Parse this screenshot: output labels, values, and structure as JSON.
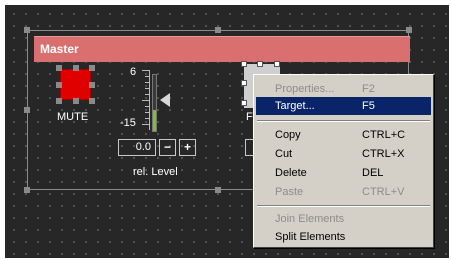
{
  "group": {
    "title": "Master"
  },
  "mute": {
    "label": "MUTE",
    "color": "#e00000"
  },
  "level": {
    "max_label": "6",
    "min_label": "-15",
    "value": "0.0",
    "minus_label": "−",
    "plus_label": "+",
    "caption": "rel. Level"
  },
  "partial": {
    "label": "F"
  },
  "context_menu": {
    "items": [
      {
        "label": "Properties...",
        "shortcut": "F2",
        "enabled": false,
        "highlighted": false
      },
      {
        "label": "Target...",
        "shortcut": "F5",
        "enabled": true,
        "highlighted": true
      },
      {
        "label": "Copy",
        "shortcut": "CTRL+C",
        "enabled": true,
        "highlighted": false
      },
      {
        "label": "Cut",
        "shortcut": "CTRL+X",
        "enabled": true,
        "highlighted": false
      },
      {
        "label": "Delete",
        "shortcut": "DEL",
        "enabled": true,
        "highlighted": false
      },
      {
        "label": "Paste",
        "shortcut": "CTRL+V",
        "enabled": false,
        "highlighted": false
      },
      {
        "label": "Join Elements",
        "shortcut": "",
        "enabled": false,
        "highlighted": false
      },
      {
        "label": "Split Elements",
        "shortcut": "",
        "enabled": true,
        "highlighted": false
      }
    ]
  },
  "colors": {
    "canvas_bg": "#272727",
    "title_bar": "#d9706f",
    "menu_bg": "#d4d0c8",
    "menu_highlight": "#0a246a",
    "meter_fill": "#7fbf2f"
  }
}
